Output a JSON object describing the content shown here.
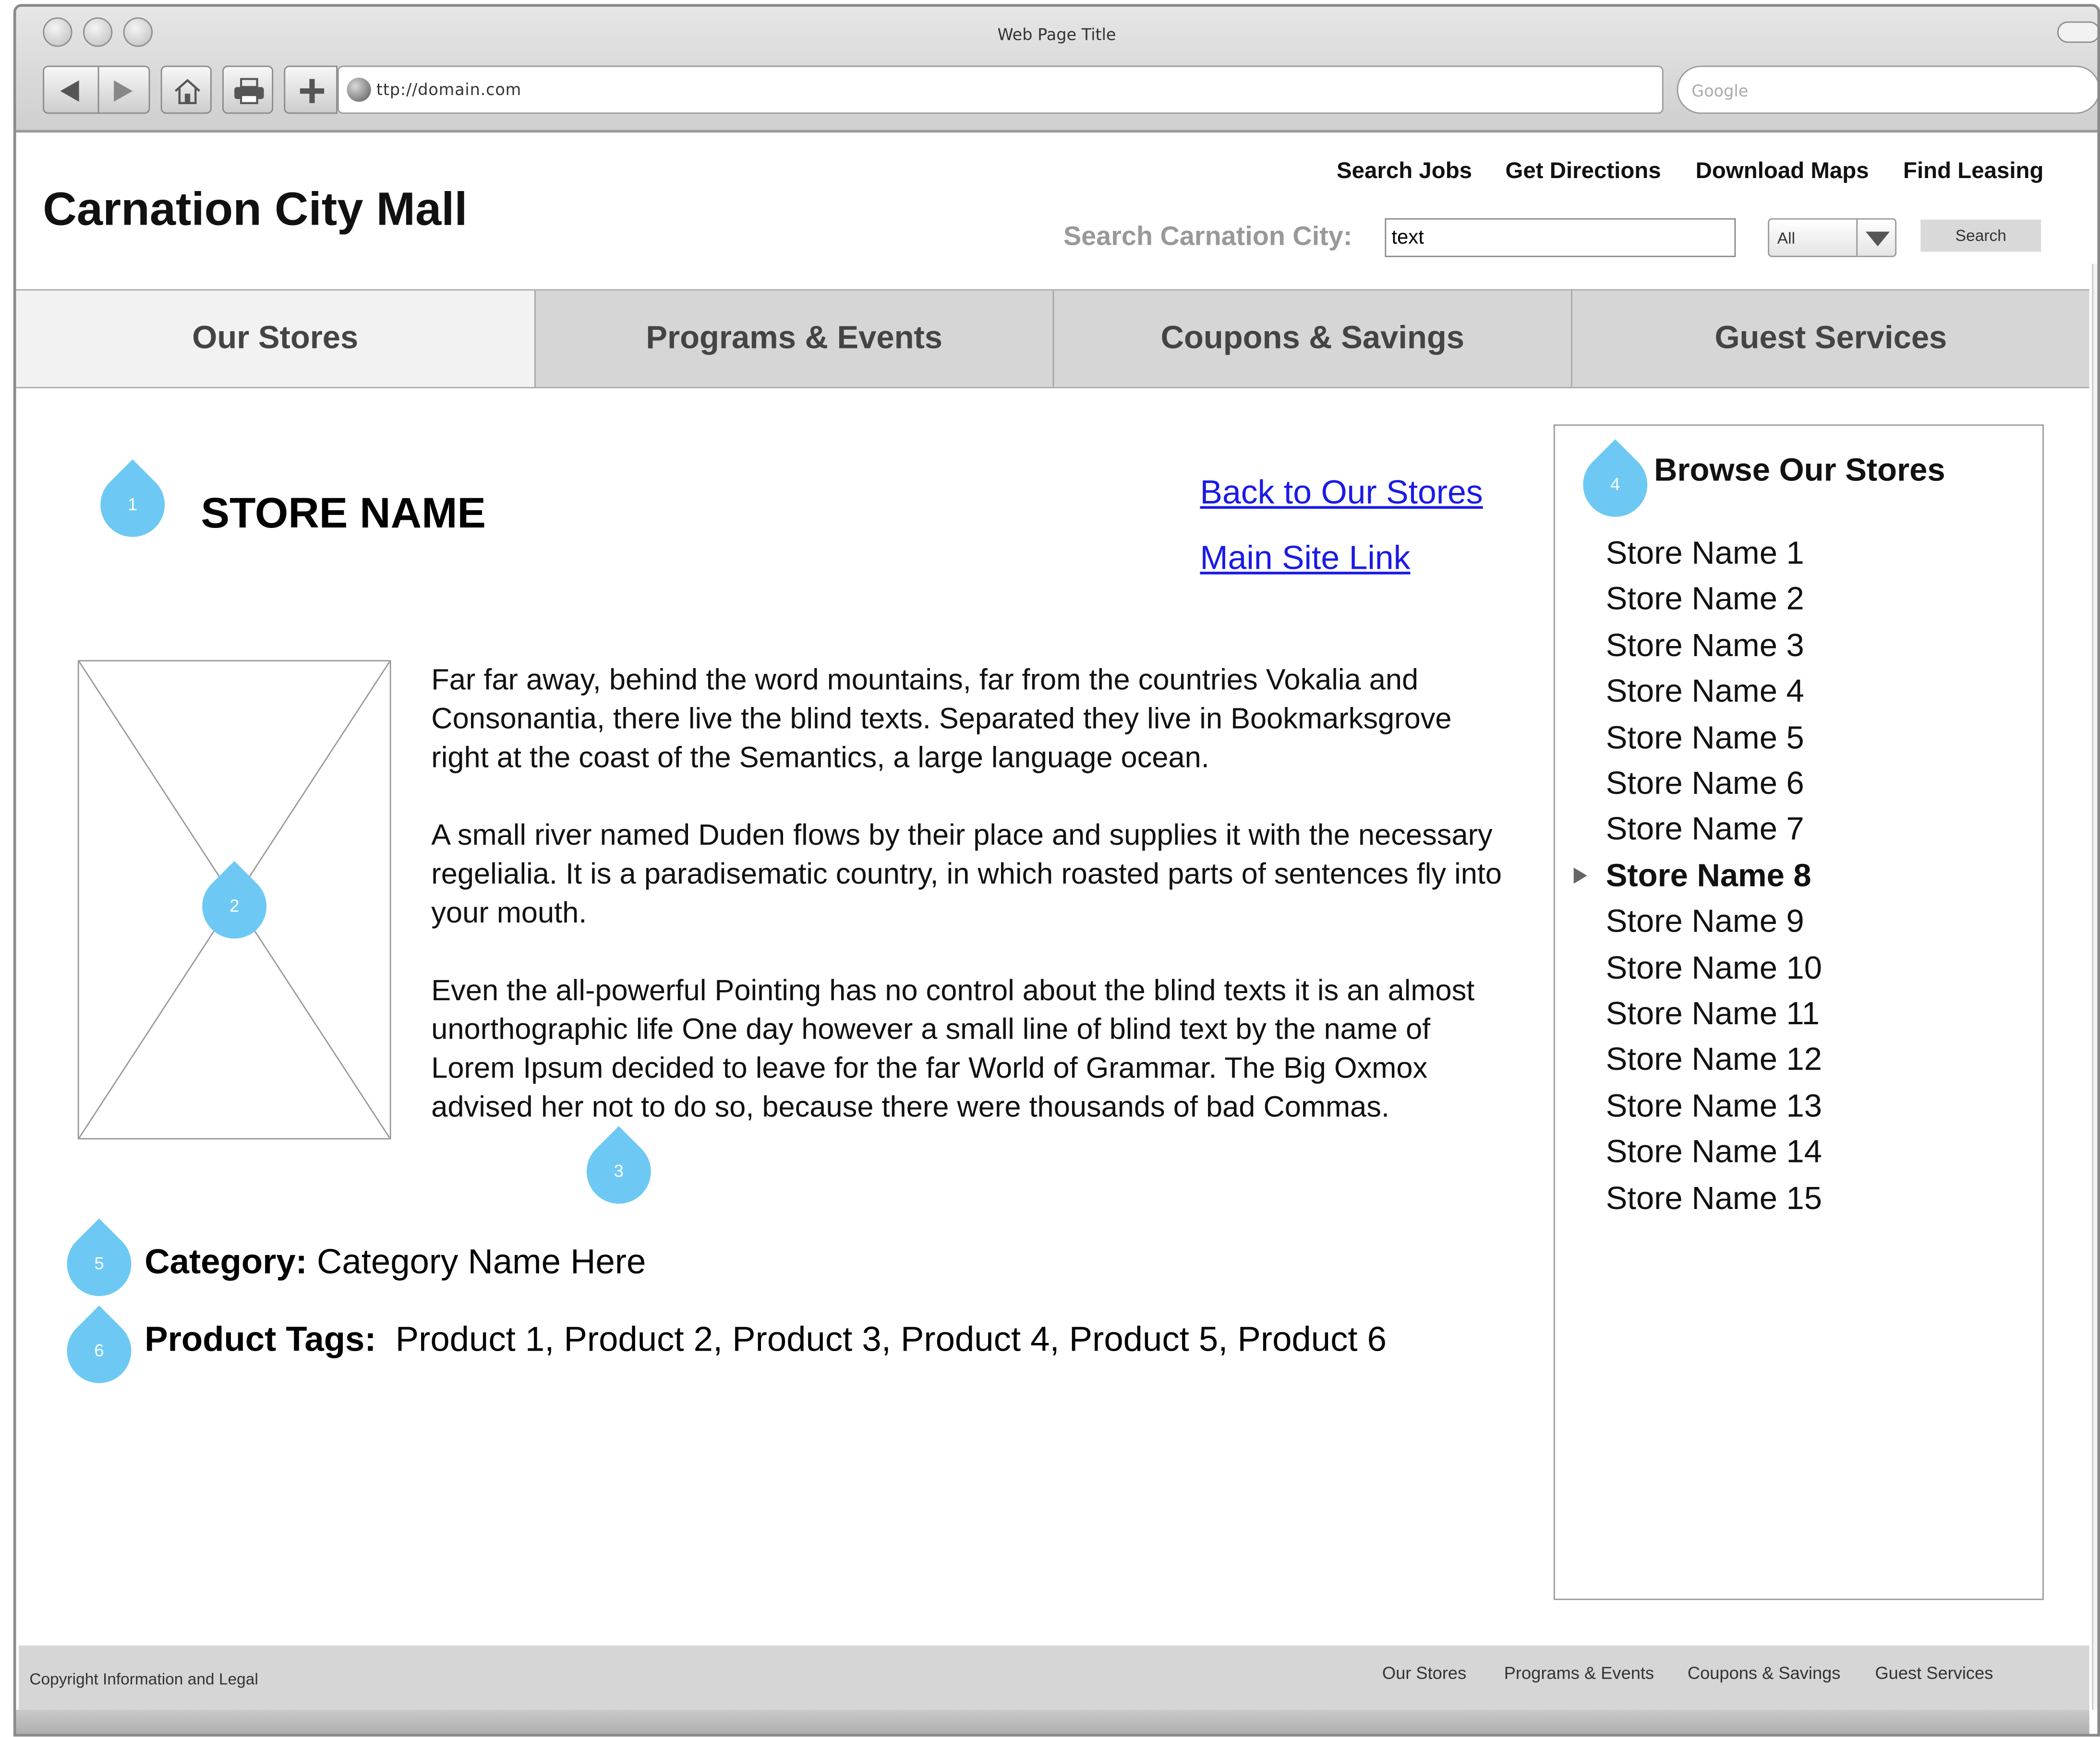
{
  "browser": {
    "window_title": "Web Page Title",
    "url": "ttp://domain.com",
    "search_placeholder": "Google"
  },
  "header": {
    "logo": "Carnation City Mall",
    "utility_links": [
      "Search Jobs",
      "Get Directions",
      "Download Maps",
      "Find Leasing"
    ],
    "search_label": "Search Carnation City:",
    "search_value": "text",
    "scope_selected": "All",
    "search_button": "Search"
  },
  "nav": {
    "tabs": [
      "Our Stores",
      "Programs & Events",
      "Coupons & Savings",
      "Guest Services"
    ],
    "active": "Our Stores"
  },
  "store": {
    "name": "STORE NAME",
    "back_link": "Back to Our Stores",
    "main_link": "Main Site Link",
    "description": [
      "Far far away, behind the word mountains, far from the countries Vokalia and Consonantia, there live the blind texts. Separated they live in Bookmarksgrove right at the coast of the Semantics, a large language ocean.",
      "A small river named Duden flows by their place and supplies it with the necessary regelialia. It is a paradisematic country, in which roasted parts of sentences fly into your mouth.",
      "Even the all-powerful Pointing has no control about the blind texts it is an almost unorthographic life One day however a small line of blind text by the name of Lorem Ipsum decided to leave for the far World of Grammar. The Big Oxmox advised her not to do so, because there were thousands of bad Commas."
    ],
    "category_label": "Category:",
    "category_value": "Category Name Here",
    "tags_label": "Product Tags:",
    "tags_value": "Product 1, Product 2, Product 3, Product 4, Product 5, Product 6"
  },
  "annotations": [
    "1",
    "2",
    "3",
    "4",
    "5",
    "6"
  ],
  "sidebar": {
    "title": "Browse Our Stores",
    "stores": [
      "Store Name 1",
      "Store Name 2",
      "Store Name 3",
      "Store Name 4",
      "Store Name 5",
      "Store Name 6",
      "Store Name 7",
      "Store Name 8",
      "Store Name 9",
      "Store Name 10",
      "Store Name 11",
      "Store Name 12",
      "Store Name 13",
      "Store Name 14",
      "Store Name 15"
    ],
    "current": "Store Name 8"
  },
  "footer": {
    "copyright": "Copyright Information and Legal",
    "links": [
      "Our Stores",
      "Programs & Events",
      "Coupons & Savings",
      "Guest Services"
    ]
  },
  "colors": {
    "marker": "#6dc9f3",
    "link": "#1a1ae6",
    "nav_tab": "#d6d6d6",
    "nav_tab_active": "#f2f2f2"
  }
}
